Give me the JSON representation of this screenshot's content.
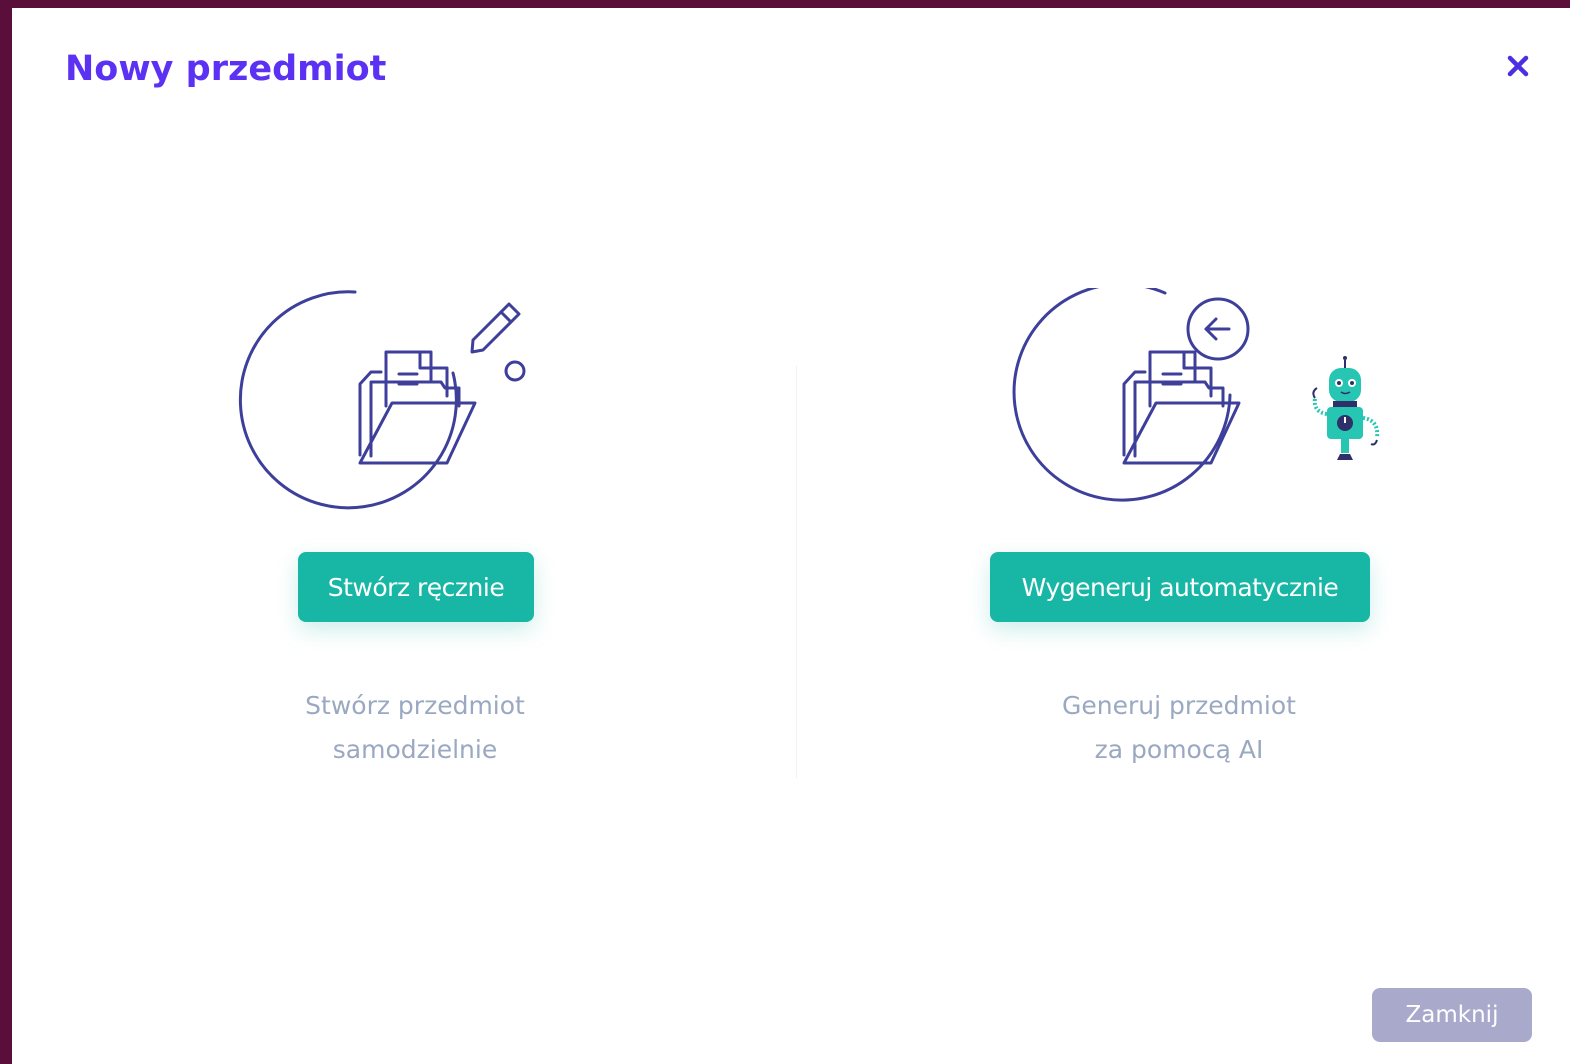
{
  "modal": {
    "title": "Nowy przedmiot",
    "close_icon": "close-icon",
    "accent_color": "#5b32f4"
  },
  "options": [
    {
      "id": "manual",
      "illustration": "folder-with-pencil-illustration",
      "button_label": "Stwórz ręcznie",
      "description_line1": "Stwórz przedmiot",
      "description_line2": "samodzielnie"
    },
    {
      "id": "auto",
      "illustration": "folder-with-robot-illustration",
      "button_label": "Wygeneruj automatycznie",
      "description_line1": "Generuj przedmiot",
      "description_line2": "za pomocą AI"
    }
  ],
  "footer": {
    "close_label": "Zamknij"
  },
  "colors": {
    "primary_button": "#18b7a5",
    "secondary_button": "#a8a9cb",
    "muted_text": "#9aa8c2",
    "illustration_stroke": "#3d3f9a"
  }
}
